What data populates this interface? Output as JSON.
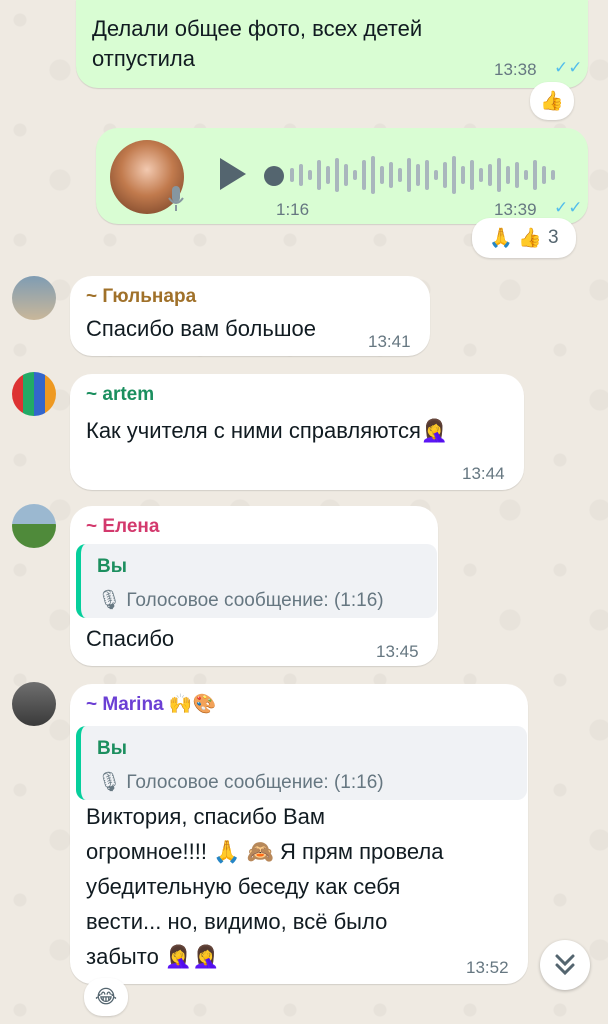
{
  "messages": [
    {
      "text": "Делали общее фото, всех детей отпустила",
      "time": "13:38",
      "reaction": "👍"
    },
    {
      "voice_duration": "1:16",
      "time": "13:39",
      "reactions": "🙏 👍",
      "reaction_count": "3"
    },
    {
      "sender": "~ Гюльнара",
      "text": "Спасибо вам большое",
      "time": "13:41"
    },
    {
      "sender": "~ artem",
      "text": "Как учителя с ними справляются🤦‍♀️",
      "time": "13:44"
    },
    {
      "sender": "~ Елена",
      "quote_name": "Вы",
      "quote_text": "Голосовое сообщение: (1:16)",
      "text": "Спасибо",
      "time": "13:45"
    },
    {
      "sender": "~ Marina 🙌🎨",
      "quote_name": "Вы",
      "quote_text": "Голосовое сообщение: (1:16)",
      "text_lines": [
        "Виктория, спасибо Вам",
        "огромное!!!! 🙏 🙈 Я прям провела",
        "убедительную беседу как себя",
        "вести...  но, видимо, всё было",
        "забыто 🤦‍♀️🤦‍♀️"
      ],
      "time": "13:52",
      "reaction": "😂"
    }
  ],
  "colors": {
    "gulnara": "#a0712a",
    "artem": "#1b8f5f",
    "elena": "#d3396d",
    "marina": "#6b3fd4",
    "ticks": "#53bdeb"
  },
  "icons": {
    "scroll_down": "chevron-double-down-icon",
    "play": "play-icon",
    "mic": "mic-icon"
  }
}
